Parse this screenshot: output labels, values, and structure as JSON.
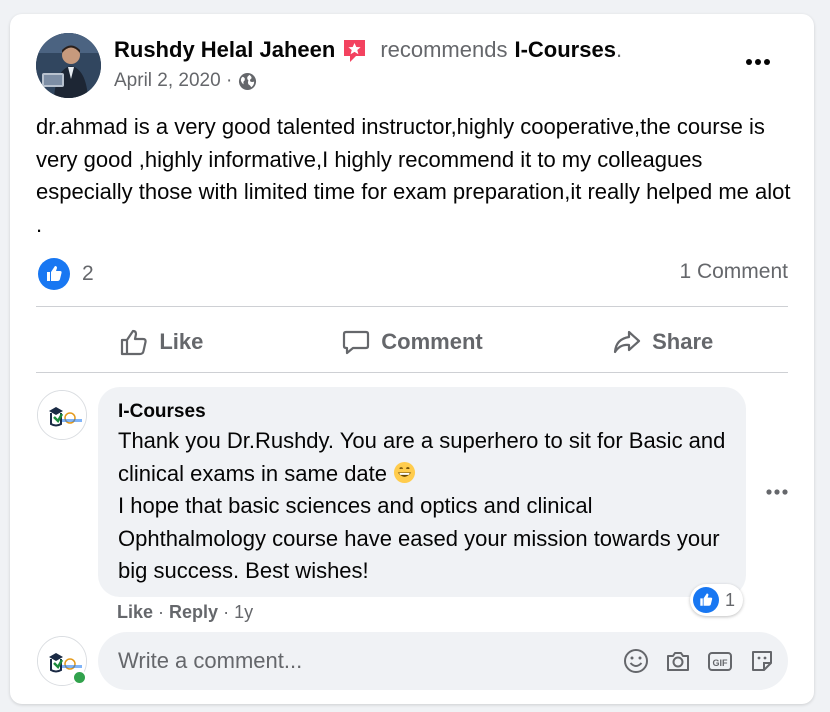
{
  "post": {
    "author": "Rushdy Helal Jaheen",
    "action_text": "recommends",
    "page_name": "I-Courses",
    "page_suffix": ".",
    "date": "April 2, 2020 ·",
    "text": "dr.ahmad is a very good talented instructor,highly cooperative,the course is very good ,highly informative,I highly recommend it to my colleagues especially those with limited time for exam preparation,it really helped me alot ."
  },
  "stats": {
    "like_count": "2",
    "comment_count": "1 Comment"
  },
  "actions": {
    "like": "Like",
    "comment": "Comment",
    "share": "Share"
  },
  "comment": {
    "author": "I-Courses",
    "line1": "Thank you Dr.Rushdy. You are a superhero to sit for Basic and clinical exams in same date",
    "emoji": "grinning-face-emoji",
    "line2": "I hope that basic sciences and optics and clinical Ophthalmology course have eased your mission towards your big success. Best wishes!",
    "like_label": "Like",
    "reply_label": "Reply",
    "age": "1y",
    "reaction_count": "1"
  },
  "composer": {
    "placeholder": "Write a comment..."
  },
  "colors": {
    "facebook_blue": "#1877f2",
    "secondary_text": "#65676b",
    "bubble_bg": "#f0f2f5",
    "badge_pink": "#f3425f",
    "online_green": "#31a24c"
  }
}
